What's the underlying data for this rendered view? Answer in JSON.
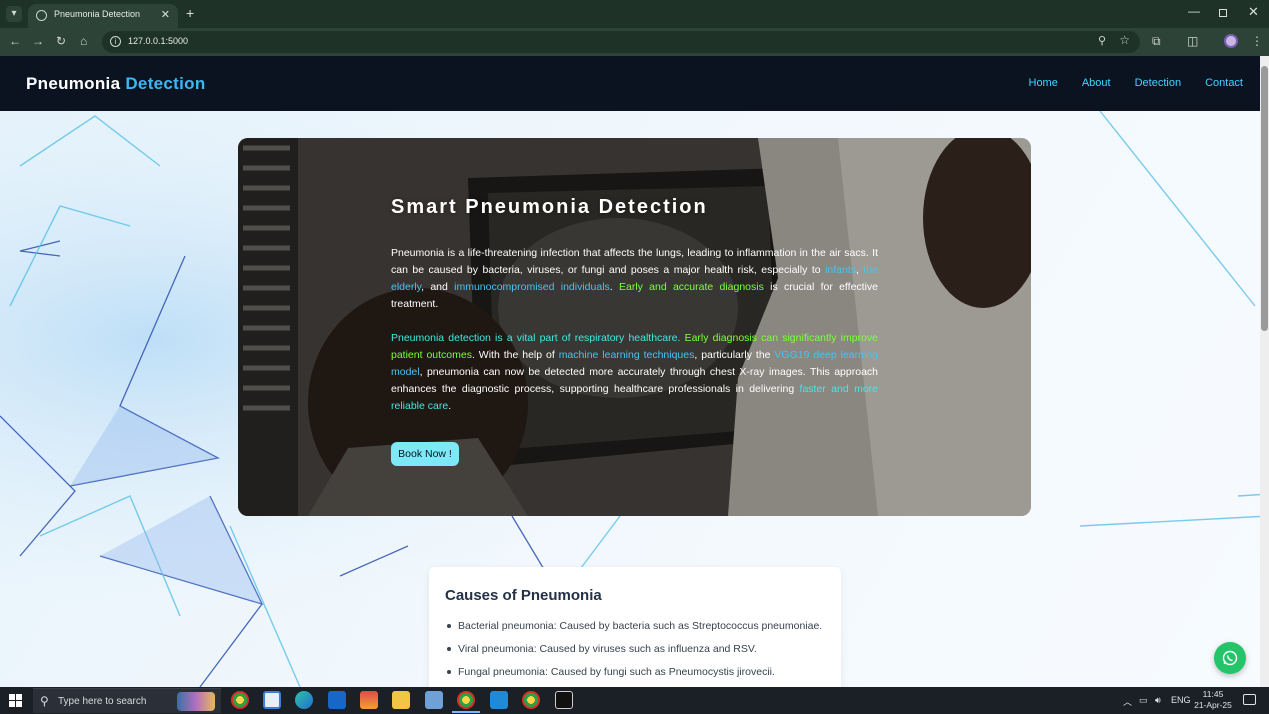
{
  "browser": {
    "tab_title": "Pneumonia Detection",
    "url": "127.0.0.1:5000"
  },
  "navbar": {
    "brand_main": "Pneumonia",
    "brand_accent": "Detection",
    "links": [
      "Home",
      "About",
      "Detection",
      "Contact"
    ]
  },
  "hero": {
    "title": "Smart Pneumonia Detection",
    "p1": {
      "t1": "Pneumonia is a life-threatening infection that affects the lungs, leading to inflammation in the air sacs. It can be caused by bacteria, viruses, or fungi and poses a major health risk, especially to ",
      "infants": "infants",
      "sep1": ", ",
      "elderly": "the elderly",
      "sep2": ", and ",
      "immuno": "immunocompromised individuals",
      "sep3": ". ",
      "early": "Early and accurate diagnosis",
      "t2": " is crucial for effective treatment."
    },
    "p2": {
      "vital": "Pneumonia detection is a vital part of respiratory healthcare.",
      "sep1": " ",
      "early": "Early diagnosis can significantly improve patient outcomes",
      "t1": ". With the help of ",
      "ml": "machine learning techniques",
      "t2": ", particularly the ",
      "vgg": "VGG19 deep learning model",
      "t3": ", pneumonia can now be detected more accurately through chest X-ray images. This approach enhances the diagnostic process, supporting healthcare professionals in delivering ",
      "faster": "faster and more reliable care",
      "t4": "."
    },
    "button": "Book Now !"
  },
  "causes": {
    "title": "Causes of Pneumonia",
    "items": [
      "Bacterial pneumonia: Caused by bacteria such as Streptococcus pneumoniae.",
      "Viral pneumonia: Caused by viruses such as influenza and RSV.",
      "Fungal pneumonia: Caused by fungi such as Pneumocystis jirovecii."
    ]
  },
  "taskbar": {
    "search_placeholder": "Type here to search",
    "language": "ENG",
    "time": "11:45",
    "date": "21-Apr-25"
  },
  "colors": {
    "navbar_bg": "#0b1320",
    "brand_accent": "#3fb6f2",
    "nav_link": "#43d4ff",
    "button_bg": "#7de9f7",
    "highlight_blue": "#49c3ef",
    "highlight_green": "#7cff3c",
    "highlight_cyan": "#43e8e3",
    "whatsapp": "#25c46a"
  }
}
